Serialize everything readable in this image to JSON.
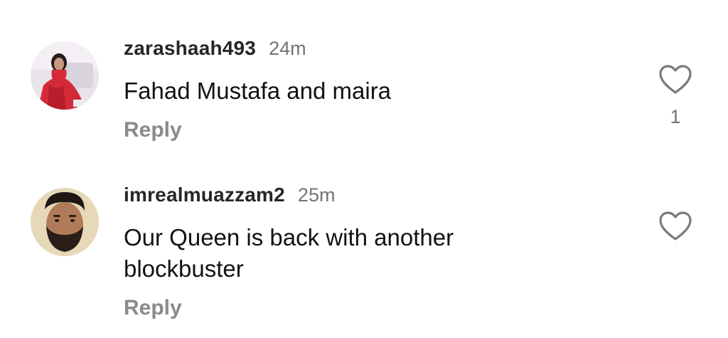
{
  "comments": [
    {
      "username": "zarashaah493",
      "time": "24m",
      "text": "Fahad Mustafa and maira",
      "reply_label": "Reply",
      "likes": "1",
      "avatar_icon": "profile-photo-woman-red-dress",
      "like_icon": "heart-outline-icon"
    },
    {
      "username": "imrealmuazzam2",
      "time": "25m",
      "text": "Our Queen is back with another blockbuster",
      "reply_label": "Reply",
      "likes": "",
      "avatar_icon": "profile-photo-bearded-man",
      "like_icon": "heart-outline-icon"
    }
  ],
  "colors": {
    "username": "#262626",
    "meta": "#737373",
    "reply": "#8a8a8a",
    "background": "#ffffff"
  }
}
